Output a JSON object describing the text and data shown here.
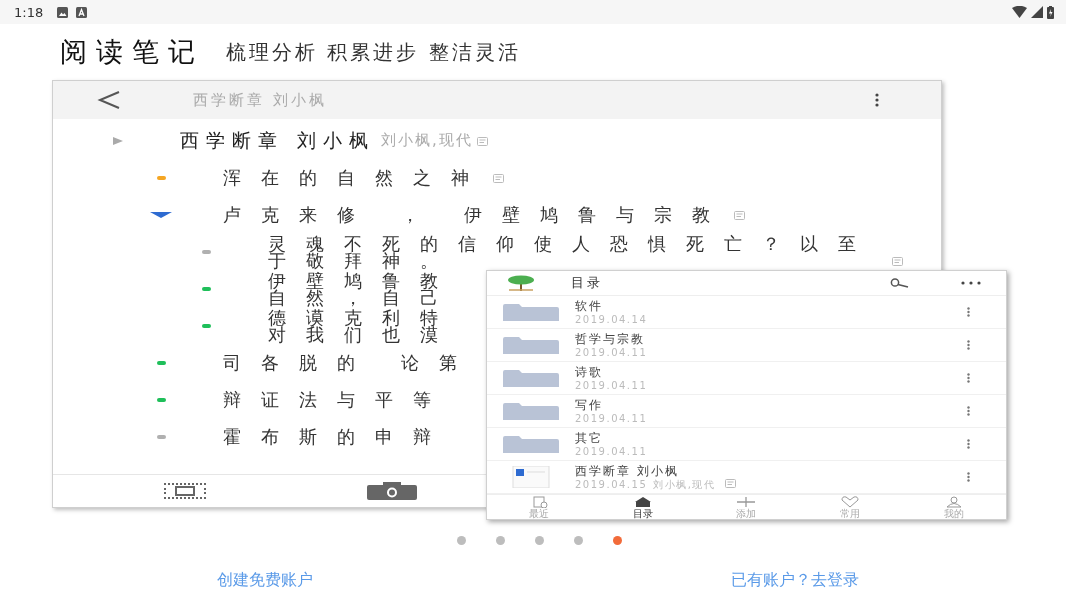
{
  "status_bar": {
    "time": "1:18"
  },
  "title": "阅读笔记",
  "subtitle": "梳理分析 积累进步 整洁灵活",
  "outline_screen": {
    "header_title": "西学断章  刘小枫",
    "tree": [
      {
        "text": "西学断章  刘小枫",
        "tags": "刘小枫,现代",
        "note": true,
        "expanded": false,
        "children": [
          {
            "text": "浑在的自然之神",
            "note": true,
            "color": "#f5a623"
          },
          {
            "text": "卢克来修 ， 伊壁鸠鲁与宗教",
            "note": true,
            "expanded": true,
            "children": [
              {
                "text": "灵魂不死的信仰使人恐惧死亡？以至于敬拜神。",
                "note": true,
                "color": "#b0b0b0"
              },
              {
                "lines": [
                  "伊壁鸠鲁教",
                  "自然，自己"
                ],
                "note": false,
                "color": "#1fbf5a"
              },
              {
                "lines": [
                  "德谟克利特",
                  "对我们也漠"
                ],
                "note": false,
                "color": "#1fbf5a"
              }
            ]
          },
          {
            "text": "司各脱的 论第",
            "note": false,
            "color": "#1fbf5a"
          },
          {
            "text": "辩证法与平等",
            "note": false,
            "color": "#1fbf5a"
          },
          {
            "text": "霍布斯的申辩",
            "note": false,
            "color": "#b0b0b0"
          }
        ]
      }
    ]
  },
  "catalog_screen": {
    "title": "目录",
    "items": [
      {
        "kind": "folder",
        "name": "软件",
        "date": "2019.04.14"
      },
      {
        "kind": "folder",
        "name": "哲学与宗教",
        "date": "2019.04.11"
      },
      {
        "kind": "folder",
        "name": "诗歌",
        "date": "2019.04.11"
      },
      {
        "kind": "folder",
        "name": "写作",
        "date": "2019.04.11"
      },
      {
        "kind": "folder",
        "name": "其它",
        "date": "2019.04.11"
      },
      {
        "kind": "book",
        "name": "西学断章  刘小枫",
        "date": "2019.04.15",
        "tags": "刘小枫,现代",
        "note": true
      }
    ],
    "nav": [
      {
        "label": "最近",
        "selected": false
      },
      {
        "label": "目录",
        "selected": true
      },
      {
        "label": "添加",
        "selected": false
      },
      {
        "label": "常用",
        "selected": false
      },
      {
        "label": "我的",
        "selected": false
      }
    ]
  },
  "pager": [
    {
      "selected": false
    },
    {
      "selected": false
    },
    {
      "selected": false
    },
    {
      "selected": false
    },
    {
      "selected": true
    }
  ],
  "links": [
    {
      "text": "创建免费账户"
    },
    {
      "text": "已有账户？去登录"
    }
  ]
}
